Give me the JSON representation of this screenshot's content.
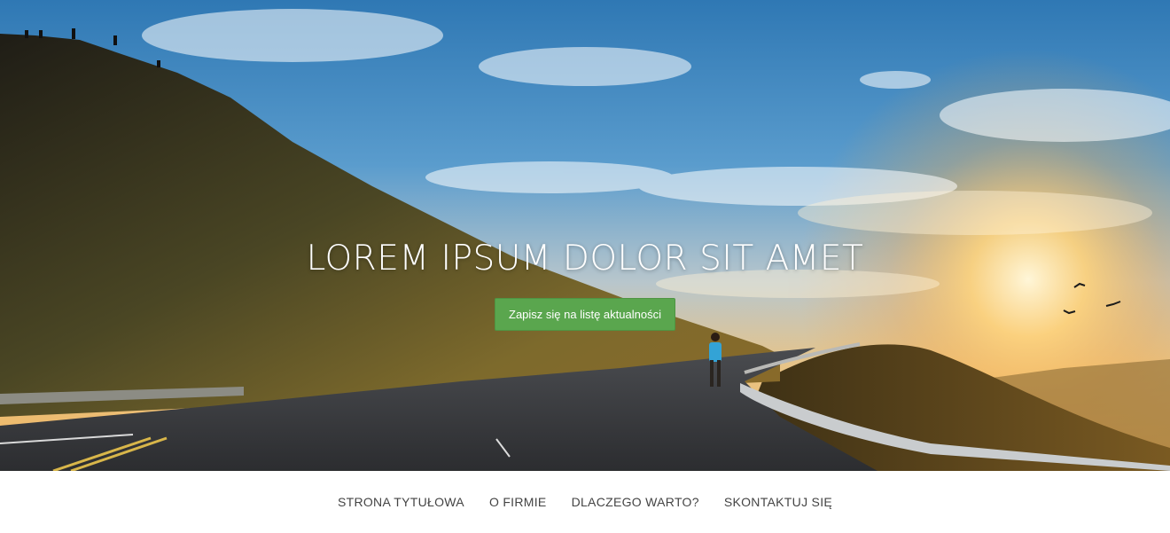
{
  "hero": {
    "title": "LOREM IPSUM DOLOR SIT AMET",
    "button_label": "Zapisz się na listę aktualności",
    "button_color": "#5aa64e"
  },
  "nav": {
    "items": [
      {
        "label": "STRONA TYTUŁOWA"
      },
      {
        "label": "O FIRMIE"
      },
      {
        "label": "DLACZEGO WARTO?"
      },
      {
        "label": "SKONTAKTUJ SIĘ"
      }
    ]
  }
}
